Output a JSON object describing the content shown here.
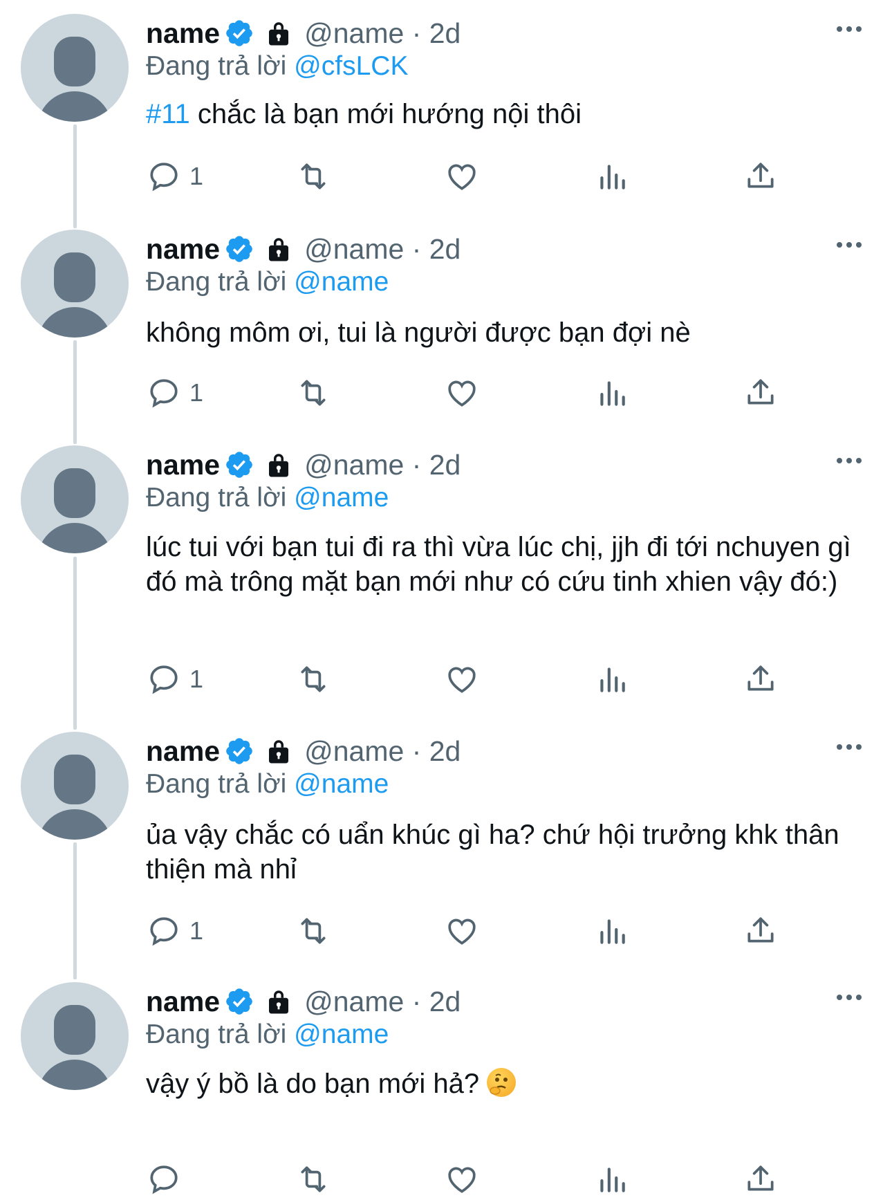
{
  "tweets": [
    {
      "name": "name",
      "handle_time": "@name · 2d",
      "replying_prefix": "Đang trả lời",
      "replying_to": "@cfsLCK",
      "hashtag": "#11",
      "text": " chắc là bạn mới hướng nội thôi",
      "reply_count": "1"
    },
    {
      "name": "name",
      "handle_time": "@name · 2d",
      "replying_prefix": "Đang trả lời",
      "replying_to": "@name",
      "text": "không môm ơi, tui là người được bạn đợi nè",
      "reply_count": "1"
    },
    {
      "name": "name",
      "handle_time": "@name · 2d",
      "replying_prefix": "Đang trả lời",
      "replying_to": "@name",
      "text": "lúc tui với bạn tui đi ra thì vừa lúc chị, jjh đi tới nchuyen gì đó mà trông mặt bạn mới như có cứu tinh xhien vậy đó:)",
      "reply_count": "1"
    },
    {
      "name": "name",
      "handle_time": "@name · 2d",
      "replying_prefix": "Đang trả lời",
      "replying_to": "@name",
      "text": "ủa vậy chắc có uẩn khúc gì ha? chứ hội trưởng khk thân thiện mà nhỉ",
      "reply_count": "1"
    },
    {
      "name": "name",
      "handle_time": "@name · 2d",
      "replying_prefix": "Đang trả lời",
      "replying_to": "@name",
      "text": "vậy ý bồ là do bạn mới hả? ",
      "emoji": "thinking-face",
      "reply_count": ""
    }
  ],
  "icons": [
    "verified-badge-icon",
    "lock-icon",
    "more-icon",
    "reply-icon",
    "retweet-icon",
    "like-icon",
    "views-icon",
    "share-icon"
  ],
  "colors": {
    "accent": "#1d9bf0",
    "secondary_text": "#536471",
    "thread_line": "#cfd9de"
  }
}
